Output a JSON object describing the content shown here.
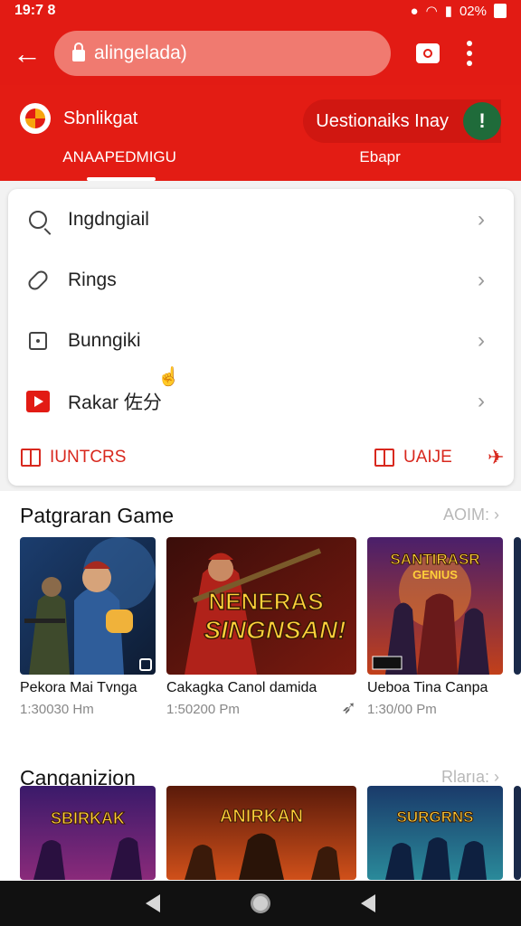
{
  "status_bar": {
    "time": "19:7 8",
    "battery": "02%"
  },
  "browser": {
    "url": "alingelada)"
  },
  "header": {
    "app_name": "Sbnlikgat",
    "promo_text": "Uestionaiks Inay",
    "promo_button": "!",
    "tabs": [
      {
        "label": "ANAAPEDMIGU"
      },
      {
        "label": "Ebapr"
      }
    ]
  },
  "menu": {
    "items": [
      {
        "label": "Ingdngiail",
        "icon": "search-icon"
      },
      {
        "label": "Rings",
        "icon": "ring-icon"
      },
      {
        "label": "Bunngiki",
        "icon": "box-icon"
      },
      {
        "label": "Rakar 佐分",
        "icon": "play-icon"
      }
    ],
    "actions": [
      {
        "label": "IUNTCRS",
        "icon": "book-icon"
      },
      {
        "label": "UAIJE",
        "icon": "book-icon"
      }
    ]
  },
  "sections": [
    {
      "title": "Patgraran Game",
      "more": "AOIM:",
      "cards": [
        {
          "title": "Pekora Mai Tvnga",
          "subtitle": "1:30030 Hm"
        },
        {
          "title": "Cakagka Canol damida",
          "subtitle": "1:50200 Pm",
          "art_text": "NENERAS SINGNSAN!"
        },
        {
          "title": "Ueboa Tina Canpa",
          "subtitle": "1:30/00 Pm",
          "art_text": "SANTIRASR GENIUS"
        }
      ]
    },
    {
      "title": "Canganizion",
      "more": "Rlarıa:",
      "cards": [
        {
          "art_text": "SBIRKAK"
        },
        {
          "art_text": "ANIRKAN"
        },
        {
          "art_text": "SURGRNS"
        }
      ]
    }
  ],
  "colors": {
    "brand_red": "#e21b14",
    "accent_green": "#1f6b3a"
  }
}
